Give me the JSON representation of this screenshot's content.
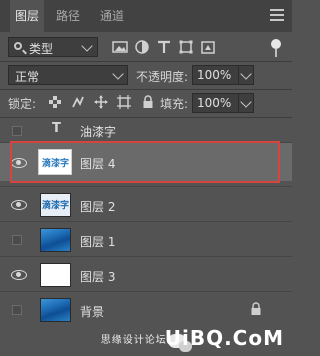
{
  "tabs": [
    {
      "label": "图层",
      "active": true
    },
    {
      "label": "路径",
      "active": false
    },
    {
      "label": "通道",
      "active": false
    }
  ],
  "filter": {
    "label": "类型"
  },
  "blend": {
    "mode": "正常",
    "opacity_label": "不透明度:",
    "opacity_value": "100%"
  },
  "lock": {
    "label": "锁定:",
    "fill_label": "填充:",
    "fill_value": "100%"
  },
  "layers": [
    {
      "name": "油漆字",
      "type": "text",
      "visible": false,
      "selected": false
    },
    {
      "name": "图层 4",
      "type": "text-thumb",
      "visible": true,
      "selected": true,
      "thumb_text": "滴漆字"
    },
    {
      "name": "图层 2",
      "type": "text-blue",
      "visible": true,
      "selected": false,
      "thumb_text": "滴漆字"
    },
    {
      "name": "图层 1",
      "type": "water",
      "visible": false,
      "selected": false
    },
    {
      "name": "图层 3",
      "type": "white",
      "visible": true,
      "selected": false
    },
    {
      "name": "背景",
      "type": "water",
      "visible": false,
      "selected": false,
      "locked": true
    }
  ],
  "watermark": {
    "brand": "UiBQ.CoM",
    "sub": "思缘设计论坛"
  },
  "colors": {
    "panel": "#535353",
    "tabbar": "#424242",
    "selected": "#6a6a6a",
    "highlight_box": "#d6443f"
  }
}
